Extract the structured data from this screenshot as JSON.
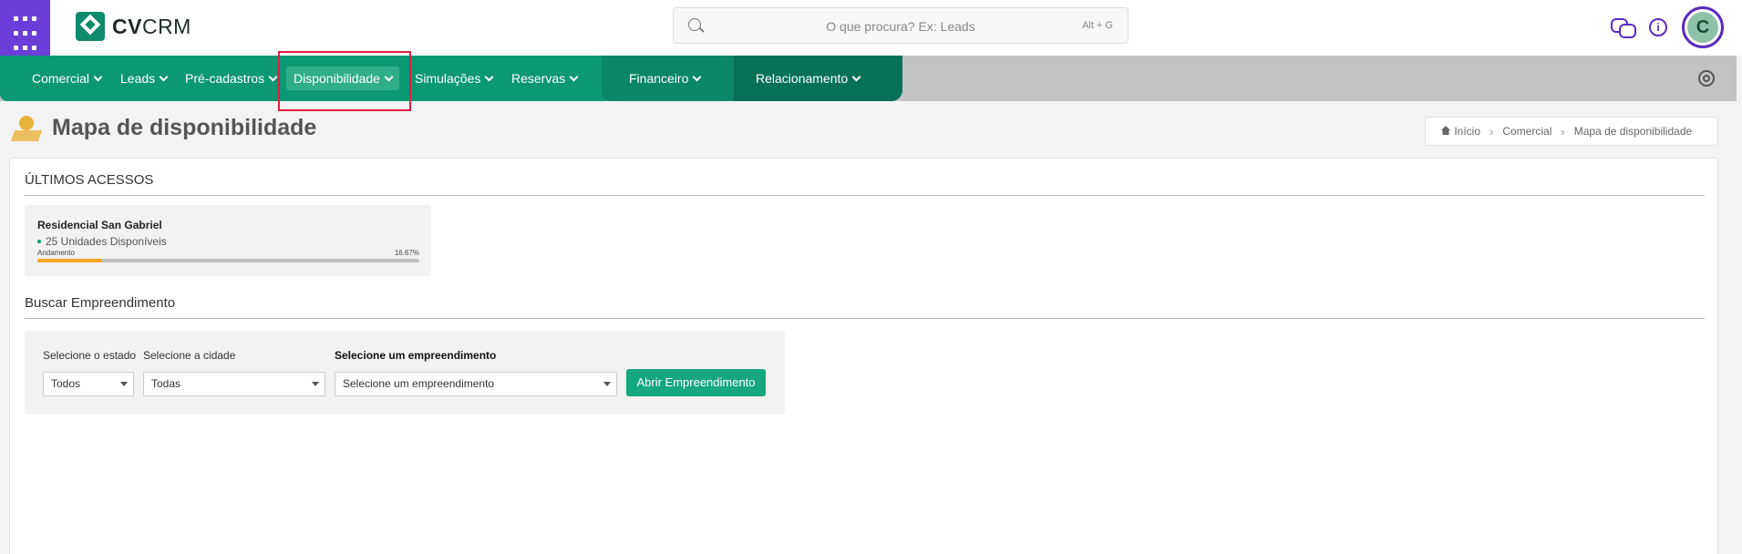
{
  "header": {
    "logo_text_bold": "CV",
    "logo_text_light": "CRM",
    "search_placeholder": "O que procura? Ex: Leads",
    "search_shortcut": "Alt + G",
    "avatar_letter": "C",
    "info_glyph": "i"
  },
  "nav": {
    "items": [
      {
        "label": "Comercial"
      },
      {
        "label": "Leads"
      },
      {
        "label": "Pré-cadastros"
      },
      {
        "label": "Disponibilidade"
      },
      {
        "label": "Simulações"
      },
      {
        "label": "Reservas"
      },
      {
        "label": "Financeiro"
      },
      {
        "label": "Relacionamento"
      }
    ],
    "active": "Disponibilidade"
  },
  "page": {
    "title": "Mapa de disponibilidade",
    "breadcrumb": [
      "Início",
      "Comercial",
      "Mapa de disponibilidade"
    ]
  },
  "recent": {
    "section_title": "ÚLTIMOS ACESSOS",
    "items": [
      {
        "name": "Residencial San Gabriel",
        "units": "25 Unidades Disponíveis",
        "progress_label": "Andamento",
        "progress_text": "16.67%",
        "progress_value": 16.67
      }
    ]
  },
  "search_section": {
    "title": "Buscar Empreendimento",
    "state_label": "Selecione o estado",
    "state_value": "Todos",
    "city_label": "Selecione a cidade",
    "city_value": "Todas",
    "project_label": "Selecione um empreendimento",
    "project_value": "Selecione um empreendimento",
    "button_label": "Abrir Empreendimento"
  },
  "colors": {
    "brand_purple": "#6a3fd8",
    "nav_green": "#0c9873",
    "button_green": "#16a77f",
    "progress_orange": "#f5a623",
    "highlight_red": "#e21f43"
  },
  "icons": [
    "apps-grid-icon",
    "search-icon",
    "chat-icon",
    "info-icon",
    "gear-icon",
    "home-icon",
    "map-pin-icon",
    "chevron-down-icon"
  ]
}
